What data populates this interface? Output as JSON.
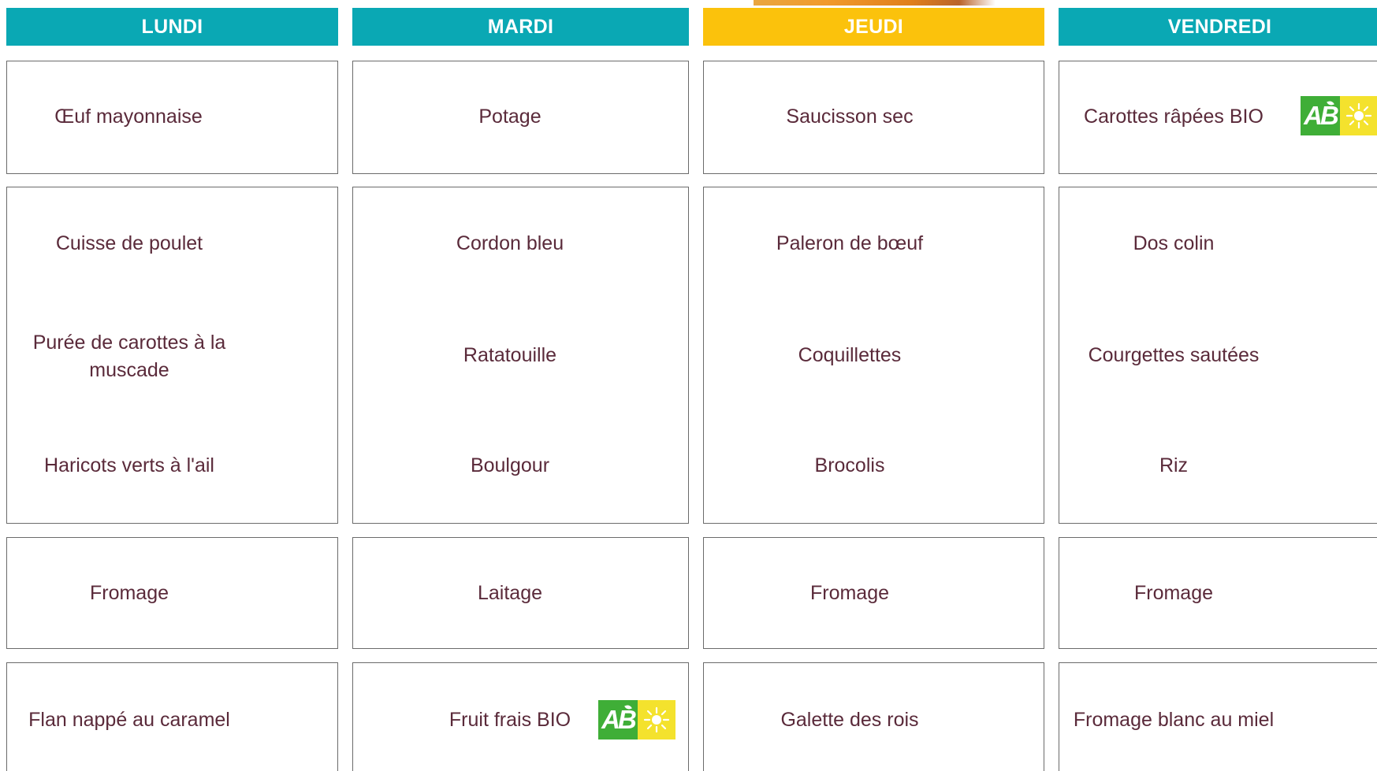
{
  "days": [
    {
      "label": "LUNDI",
      "color": "#0aa8b4"
    },
    {
      "label": "MARDI",
      "color": "#0aa8b4"
    },
    {
      "label": "JEUDI",
      "color": "#fbc20c"
    },
    {
      "label": "VENDREDI",
      "color": "#0aa8b4"
    }
  ],
  "menu": {
    "lundi": {
      "entree": "Œuf mayonnaise",
      "plat": [
        "Cuisse de poulet",
        "Purée de carottes à la muscade",
        "Haricots verts à l'ail"
      ],
      "fromage": "Fromage",
      "dessert": "Flan nappé au caramel"
    },
    "mardi": {
      "entree": "Potage",
      "plat": [
        "Cordon bleu",
        "Ratatouille",
        "Boulgour"
      ],
      "fromage": "Laitage",
      "dessert": "Fruit frais BIO"
    },
    "jeudi": {
      "entree": "Saucisson sec",
      "plat": [
        "Paleron de bœuf",
        "Coquillettes",
        "Brocolis"
      ],
      "fromage": "Fromage",
      "dessert": "Galette des rois"
    },
    "vendredi": {
      "entree": "Carottes râpées BIO",
      "plat": [
        "Dos colin",
        "Courgettes sautées",
        "Riz"
      ],
      "fromage": "Fromage",
      "dessert": "Fromage blanc au miel"
    }
  },
  "organic_logo": {
    "text": "AB",
    "green": "#3fae37",
    "yellow": "#f4e22d"
  }
}
